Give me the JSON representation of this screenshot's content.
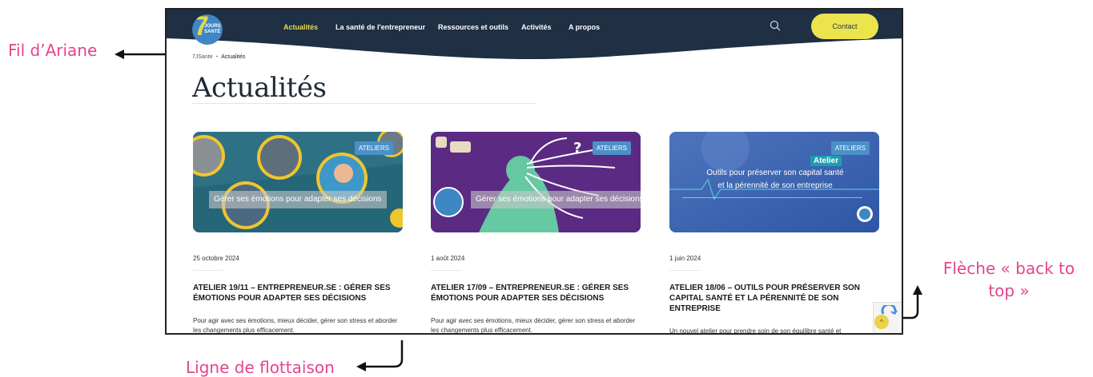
{
  "annotations": {
    "breadcrumb_label": "Fil d’Ariane",
    "fold_label": "Ligne de flottaison",
    "back_to_top_label_1": "Flèche « back to",
    "back_to_top_label_2": "top »"
  },
  "header": {
    "logo_number": "7",
    "logo_text_1": "JOURS",
    "logo_text_2": "SANTÉ",
    "nav": [
      "Actualités",
      "La santé de l'entrepreneur",
      "Ressources et outils",
      "Activités",
      "A propos"
    ],
    "active_nav": "Actualités",
    "contact_label": "Contact",
    "accent_color": "#e8dd4b",
    "navy_color": "#1f2f44"
  },
  "breadcrumb": {
    "home": "7JSante",
    "separator": "•",
    "current": "Actualités"
  },
  "page_title": "Actualités",
  "cards": [
    {
      "tag": "ATELIERS",
      "banner": "Gérer ses émotions pour adapter ses décisions",
      "date": "25 octobre 2024",
      "title": "ATELIER 19/11 – ENTREPRENEUR.SE : GÉRER SES ÉMOTIONS POUR ADAPTER SES DÉCISIONS",
      "excerpt": "Pour agir avec ses émotions, mieux décider, gérer son stress et aborder les changements plus efficacement."
    },
    {
      "tag": "ATELIERS",
      "banner": "Gérer ses émotions pour adapter ses décisions",
      "date": "1 août 2024",
      "title": "ATELIER 17/09 – ENTREPRENEUR.SE : GÉRER SES ÉMOTIONS POUR ADAPTER SES DÉCISIONS",
      "excerpt": "Pour agir avec ses émotions, mieux décider, gérer son stress et aborder les changements plus efficacement."
    },
    {
      "tag": "ATELIERS",
      "image_word": "Atelier",
      "banner_1": "Outils pour préserver son capital santé",
      "banner_2": "et la pérennité de son entreprise",
      "date": "1 juin 2024",
      "title": "ATELIER 18/06 – OUTILS POUR PRÉSERVER SON CAPITAL SANTÉ ET LA PÉRENNITÉ DE SON ENTREPRISE",
      "excerpt": "Un nouvel atelier pour prendre soin de son équilibre santé et"
    }
  ],
  "icons": {
    "search": "search-icon",
    "back_to_top": "arrow-up-icon",
    "back_to_top_glyph": "^"
  }
}
